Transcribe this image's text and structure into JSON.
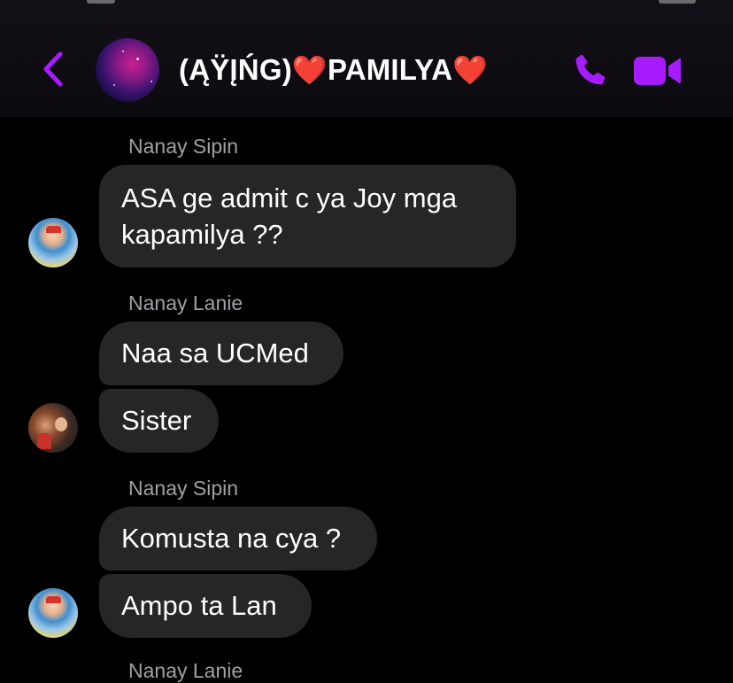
{
  "header": {
    "title": "(ĄŸĮŃG)",
    "title_name": "PAMILYA",
    "heart": "❤️",
    "back_icon": "chevron-left-icon",
    "call_icon": "phone-icon",
    "video_icon": "video-camera-icon",
    "accent_color": "#a61cff"
  },
  "messages": [
    {
      "sender": "Nanay Sipin",
      "bubbles": [
        "ASA ge admit c ya Joy mga",
        "kapamilya ??"
      ]
    },
    {
      "sender": "Nanay Lanie",
      "bubbles": [
        "Naa sa UCMed",
        "Sister"
      ]
    },
    {
      "sender": "Nanay Sipin",
      "bubbles": [
        "Komusta na cya ?",
        "Ampo ta Lan"
      ]
    },
    {
      "sender": "Nanay Lanie"
    }
  ],
  "colors": {
    "bubble_bg": "#262628",
    "sender_name": "#a0a0a5",
    "background": "#000000"
  }
}
